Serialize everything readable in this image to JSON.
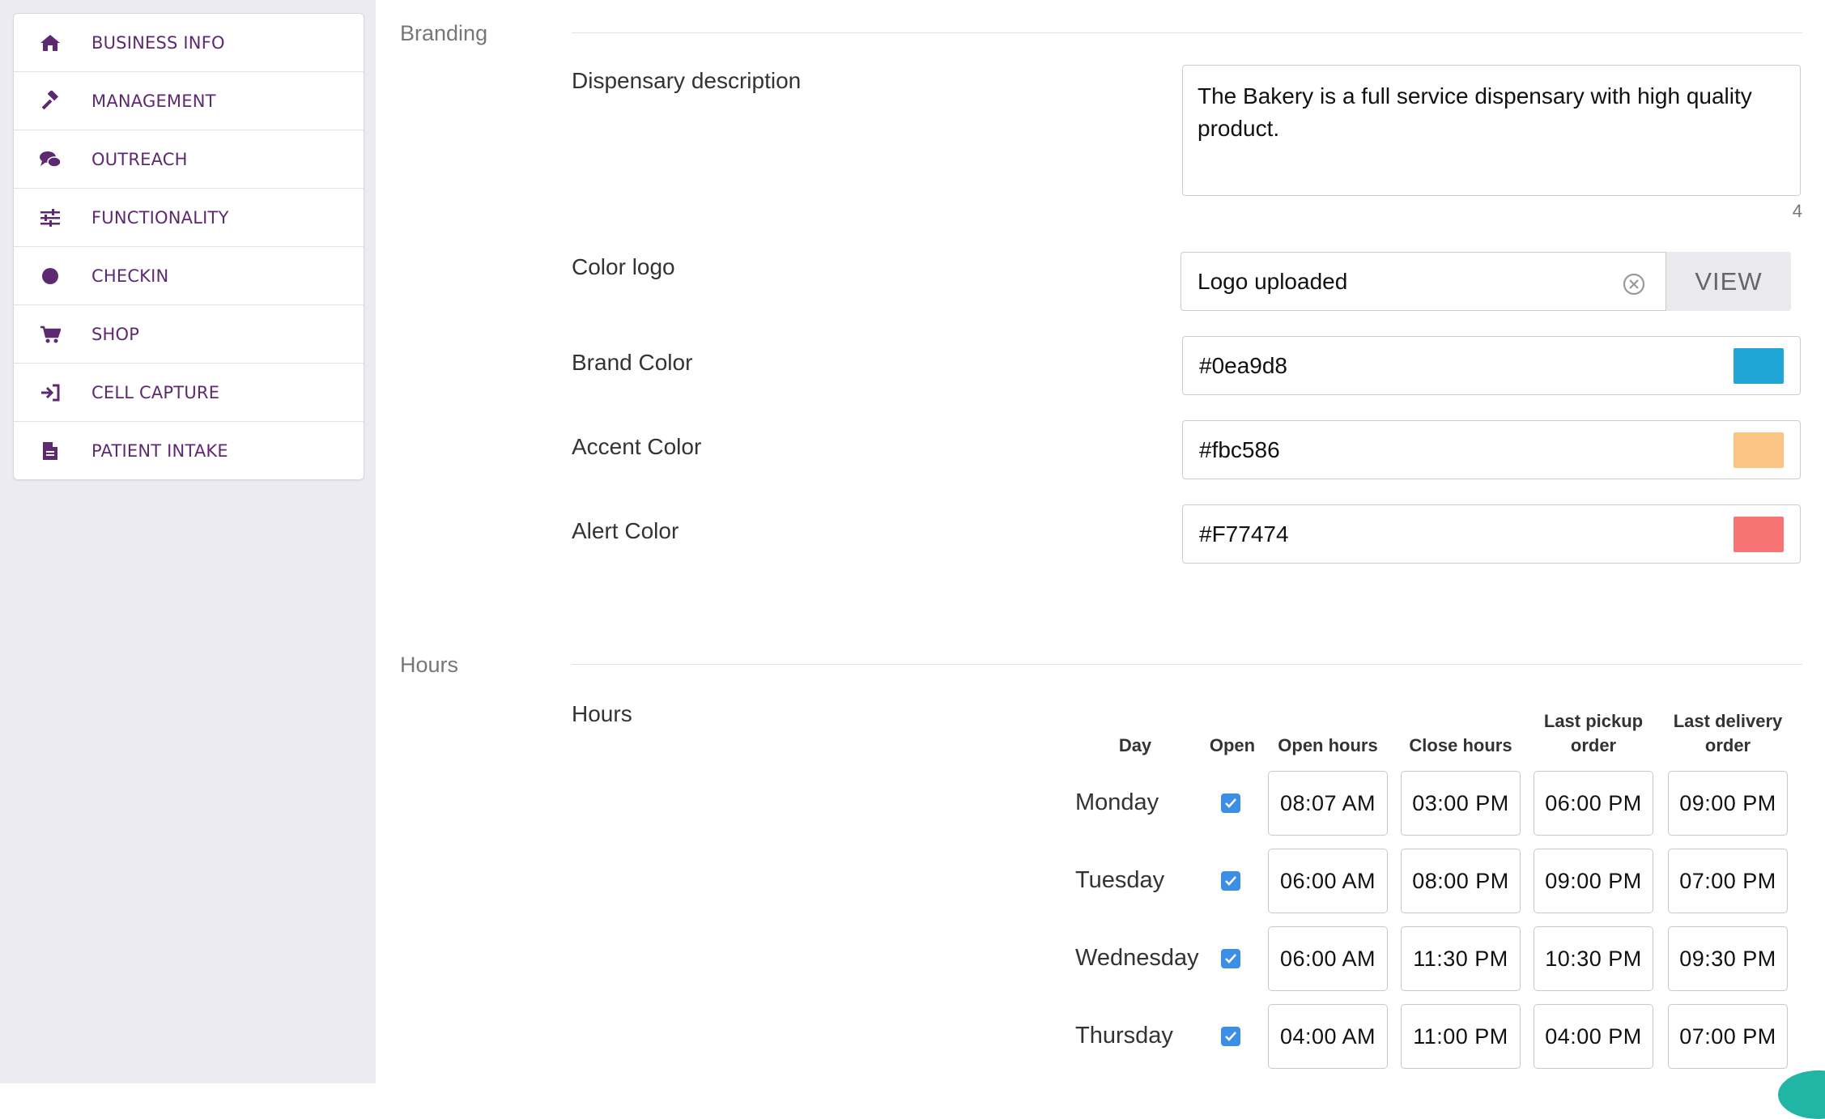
{
  "sidebar": {
    "items": [
      {
        "label": "BUSINESS INFO",
        "icon": "home-icon"
      },
      {
        "label": "MANAGEMENT",
        "icon": "gavel-icon"
      },
      {
        "label": "OUTREACH",
        "icon": "chat-bubbles-icon"
      },
      {
        "label": "FUNCTIONALITY",
        "icon": "sliders-icon"
      },
      {
        "label": "CHECKIN",
        "icon": "circle-icon"
      },
      {
        "label": "SHOP",
        "icon": "cart-icon"
      },
      {
        "label": "CELL CAPTURE",
        "icon": "sign-in-icon"
      },
      {
        "label": "PATIENT INTAKE",
        "icon": "document-icon"
      }
    ]
  },
  "branding": {
    "section_title": "Branding",
    "description_label": "Dispensary description",
    "description_value": "The Bakery is a full service dispensary with high quality product.",
    "description_counter": "4",
    "logo_label": "Color logo",
    "logo_value": "Logo uploaded",
    "view_button": "VIEW",
    "brand_color_label": "Brand Color",
    "brand_color_value": "#0ea9d8",
    "brand_swatch": "#1fa6d6",
    "accent_color_label": "Accent Color",
    "accent_color_value": "#fbc586",
    "accent_swatch": "#fbc586",
    "alert_color_label": "Alert Color",
    "alert_color_value": "#F77474",
    "alert_swatch": "#f77474"
  },
  "hours": {
    "section_title": "Hours",
    "field_label": "Hours",
    "columns": {
      "day": "Day",
      "open": "Open",
      "open_hours": "Open hours",
      "close_hours": "Close hours",
      "last_pickup_line1": "Last pickup",
      "last_pickup_line2": "order",
      "last_delivery_line1": "Last delivery",
      "last_delivery_line2": "order"
    },
    "rows": [
      {
        "day": "Monday",
        "open": true,
        "open_hours": "08:07 AM",
        "close_hours": "03:00 PM",
        "last_pickup": "06:00 PM",
        "last_delivery": "09:00 PM"
      },
      {
        "day": "Tuesday",
        "open": true,
        "open_hours": "06:00 AM",
        "close_hours": "08:00 PM",
        "last_pickup": "09:00 PM",
        "last_delivery": "07:00 PM"
      },
      {
        "day": "Wednesday",
        "open": true,
        "open_hours": "06:00 AM",
        "close_hours": "11:30 PM",
        "last_pickup": "10:30 PM",
        "last_delivery": "09:30 PM"
      },
      {
        "day": "Thursday",
        "open": true,
        "open_hours": "04:00 AM",
        "close_hours": "11:00 PM",
        "last_pickup": "04:00 PM",
        "last_delivery": "07:00 PM"
      }
    ]
  },
  "colors": {
    "nav_text": "#5d2a72",
    "sidebar_bg": "#ecebf2",
    "checkbox": "#3d8fe6"
  }
}
